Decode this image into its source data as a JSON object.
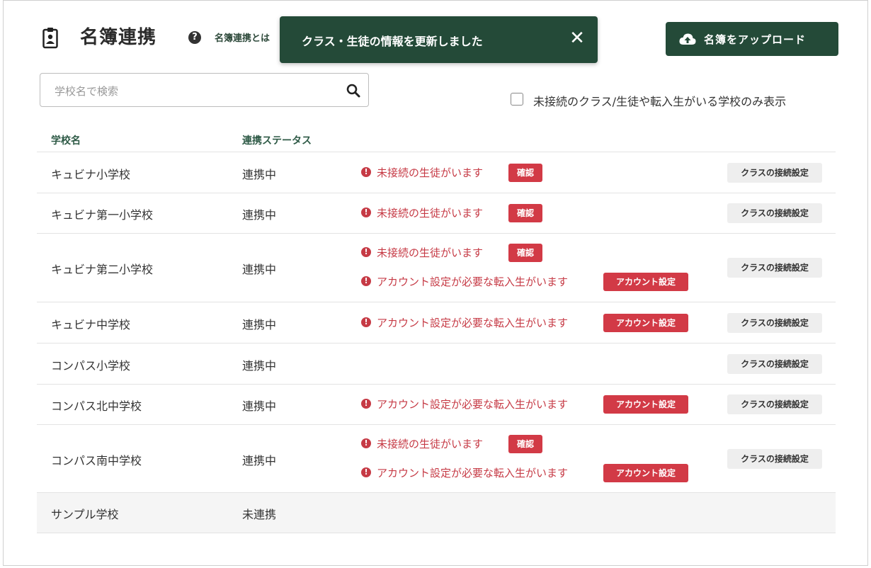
{
  "header": {
    "title": "名簿連携",
    "help_link": "名簿連携とは",
    "upload_label": "名簿をアップロード"
  },
  "toast": {
    "message": "クラス・生徒の情報を更新しました",
    "close_glyph": "✕"
  },
  "search": {
    "placeholder": "学校名で検索"
  },
  "filter": {
    "label": "未接続のクラス/生徒や転入生がいる学校のみ表示",
    "checked": false
  },
  "table": {
    "columns": [
      "学校名",
      "連携ステータス"
    ],
    "alert_unconnected": "未接続の生徒がいます",
    "alert_transfer": "アカウント設定が必要な転入生がいます",
    "confirm_label": "確認",
    "account_label": "アカウント設定",
    "connection_button": "クラスの接続設定",
    "rows": [
      {
        "name": "キュビナ小学校",
        "status": "連携中",
        "unconnected": true,
        "transfer": false
      },
      {
        "name": "キュビナ第一小学校",
        "status": "連携中",
        "unconnected": true,
        "transfer": false
      },
      {
        "name": "キュビナ第二小学校",
        "status": "連携中",
        "unconnected": true,
        "transfer": true
      },
      {
        "name": "キュビナ中学校",
        "status": "連携中",
        "unconnected": false,
        "transfer": true
      },
      {
        "name": "コンパス小学校",
        "status": "連携中",
        "unconnected": false,
        "transfer": false
      },
      {
        "name": "コンパス北中学校",
        "status": "連携中",
        "unconnected": false,
        "transfer": true
      },
      {
        "name": "コンパス南中学校",
        "status": "連携中",
        "unconnected": true,
        "transfer": true
      },
      {
        "name": "サンプル学校",
        "status": "未連携",
        "unconnected": false,
        "transfer": false
      }
    ]
  },
  "colors": {
    "brand": "#244a38",
    "alert": "#c63a45",
    "tag": "#d23a46"
  }
}
